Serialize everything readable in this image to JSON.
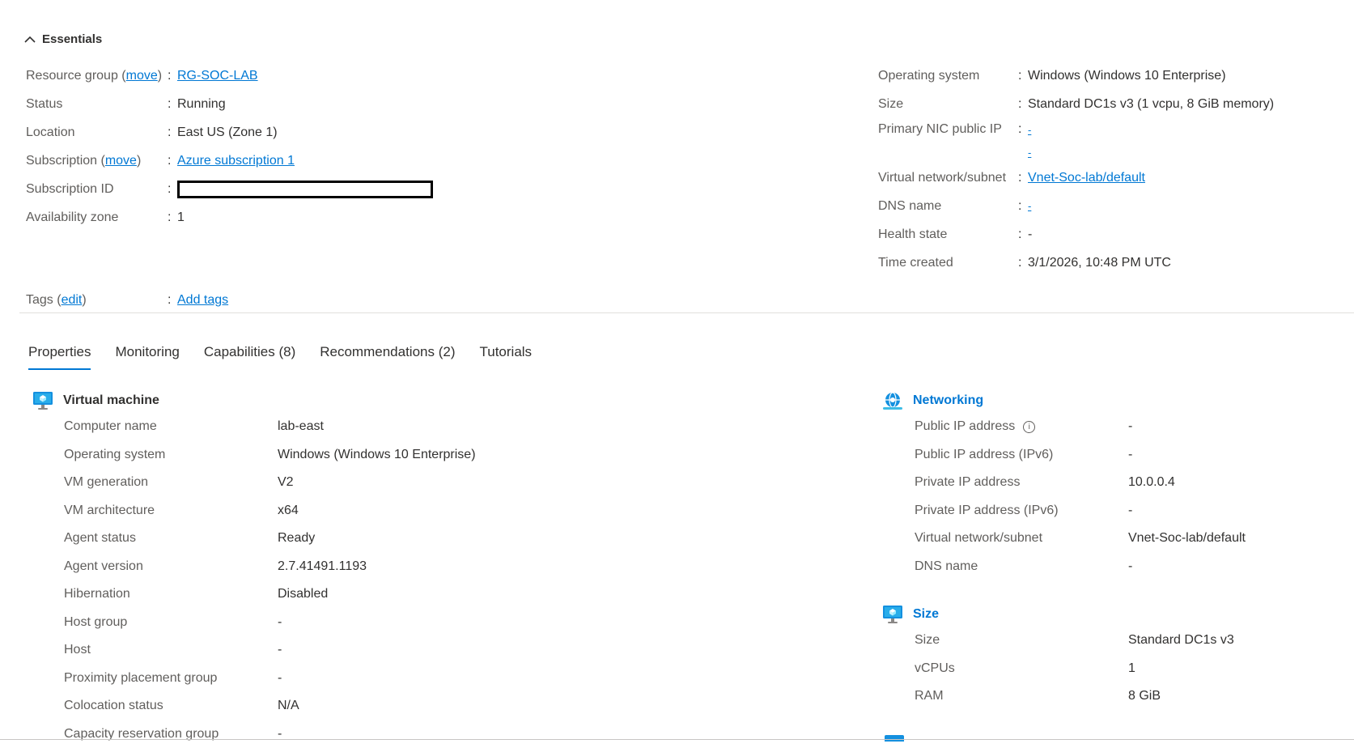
{
  "essentials": {
    "title": "Essentials",
    "left": {
      "resource_group": {
        "label": "Resource group",
        "move": "move",
        "value": "RG-SOC-LAB"
      },
      "status": {
        "label": "Status",
        "value": "Running"
      },
      "location": {
        "label": "Location",
        "value": "East US (Zone 1)"
      },
      "subscription": {
        "label": "Subscription",
        "move": "move",
        "value": "Azure subscription 1"
      },
      "subscription_id": {
        "label": "Subscription ID"
      },
      "availability_zone": {
        "label": "Availability zone",
        "value": "1"
      }
    },
    "right": {
      "operating_system": {
        "label": "Operating system",
        "value": "Windows (Windows 10 Enterprise)"
      },
      "size": {
        "label": "Size",
        "value": "Standard DC1s v3 (1 vcpu, 8 GiB memory)"
      },
      "primary_nic_public_ip": {
        "label": "Primary NIC public IP",
        "value": "-",
        "value2": "-"
      },
      "vnet_subnet": {
        "label": "Virtual network/subnet",
        "value": "Vnet-Soc-lab/default"
      },
      "dns_name": {
        "label": "DNS name",
        "value": "-"
      },
      "health_state": {
        "label": "Health state",
        "value": "-"
      },
      "time_created": {
        "label": "Time created",
        "value": "3/1/2026, 10:48 PM UTC"
      }
    },
    "tags": {
      "label": "Tags",
      "edit": "edit",
      "value": "Add tags"
    }
  },
  "tabs": [
    {
      "label": "Properties",
      "active": true
    },
    {
      "label": "Monitoring"
    },
    {
      "label": "Capabilities (8)"
    },
    {
      "label": "Recommendations (2)"
    },
    {
      "label": "Tutorials"
    }
  ],
  "vm": {
    "title": "Virtual machine",
    "rows": [
      {
        "label": "Computer name",
        "value": "lab-east"
      },
      {
        "label": "Operating system",
        "value": "Windows (Windows 10 Enterprise)"
      },
      {
        "label": "VM generation",
        "value": "V2"
      },
      {
        "label": "VM architecture",
        "value": "x64"
      },
      {
        "label": "Agent status",
        "value": "Ready"
      },
      {
        "label": "Agent version",
        "value": "2.7.41491.1193"
      },
      {
        "label": "Hibernation",
        "value": "Disabled"
      },
      {
        "label": "Host group",
        "value": "-"
      },
      {
        "label": "Host",
        "value": "-"
      },
      {
        "label": "Proximity placement group",
        "value": "-"
      },
      {
        "label": "Colocation status",
        "value": "N/A"
      },
      {
        "label": "Capacity reservation group",
        "value": "-"
      }
    ]
  },
  "networking": {
    "title": "Networking",
    "rows": [
      {
        "label": "Public IP address",
        "value": "-"
      },
      {
        "label": "Public IP address (IPv6)",
        "value": "-"
      },
      {
        "label": "Private IP address",
        "value": "10.0.0.4"
      },
      {
        "label": "Private IP address (IPv6)",
        "value": "-"
      },
      {
        "label": "Virtual network/subnet",
        "value": "Vnet-Soc-lab/default"
      },
      {
        "label": "DNS name",
        "value": "-"
      }
    ]
  },
  "size_section": {
    "title": "Size",
    "rows": [
      {
        "label": "Size",
        "value": "Standard DC1s v3"
      },
      {
        "label": "vCPUs",
        "value": "1"
      },
      {
        "label": "RAM",
        "value": "8 GiB"
      }
    ]
  },
  "colors": {
    "accent": "#0078d4",
    "text": "#323130",
    "label": "#605e5c"
  }
}
